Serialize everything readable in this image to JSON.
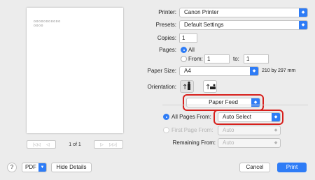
{
  "preview": {
    "placeholder_lines": [
      "ooooooooooo",
      "oooo"
    ],
    "page_count": "1 of 1",
    "first_glyph": "|◁◁",
    "prev_glyph": "◁",
    "next_glyph": "▷",
    "last_glyph": "▷▷|"
  },
  "printer": {
    "label": "Printer:",
    "value": "Canon Printer"
  },
  "presets": {
    "label": "Presets:",
    "value": "Default Settings"
  },
  "copies": {
    "label": "Copies:",
    "value": "1"
  },
  "pages": {
    "label": "Pages:",
    "all_label": "All",
    "from_label": "From:",
    "from_value": "1",
    "to_label": "to:",
    "to_value": "1"
  },
  "paper_size": {
    "label": "Paper Size:",
    "value": "A4",
    "dimensions": "210 by 297 mm"
  },
  "orientation": {
    "label": "Orientation:"
  },
  "section_menu": {
    "value": "Paper Feed"
  },
  "feed": {
    "all_pages_label": "All Pages From:",
    "all_pages_value": "Auto Select",
    "first_page_label": "First Page From:",
    "first_page_value": "Auto",
    "remaining_label": "Remaining From:",
    "remaining_value": "Auto"
  },
  "footer": {
    "help": "?",
    "pdf": "PDF",
    "hide_details": "Hide Details",
    "cancel": "Cancel",
    "print": "Print"
  },
  "colors": {
    "accent": "#2e7cf6",
    "highlight": "#d7201c"
  }
}
